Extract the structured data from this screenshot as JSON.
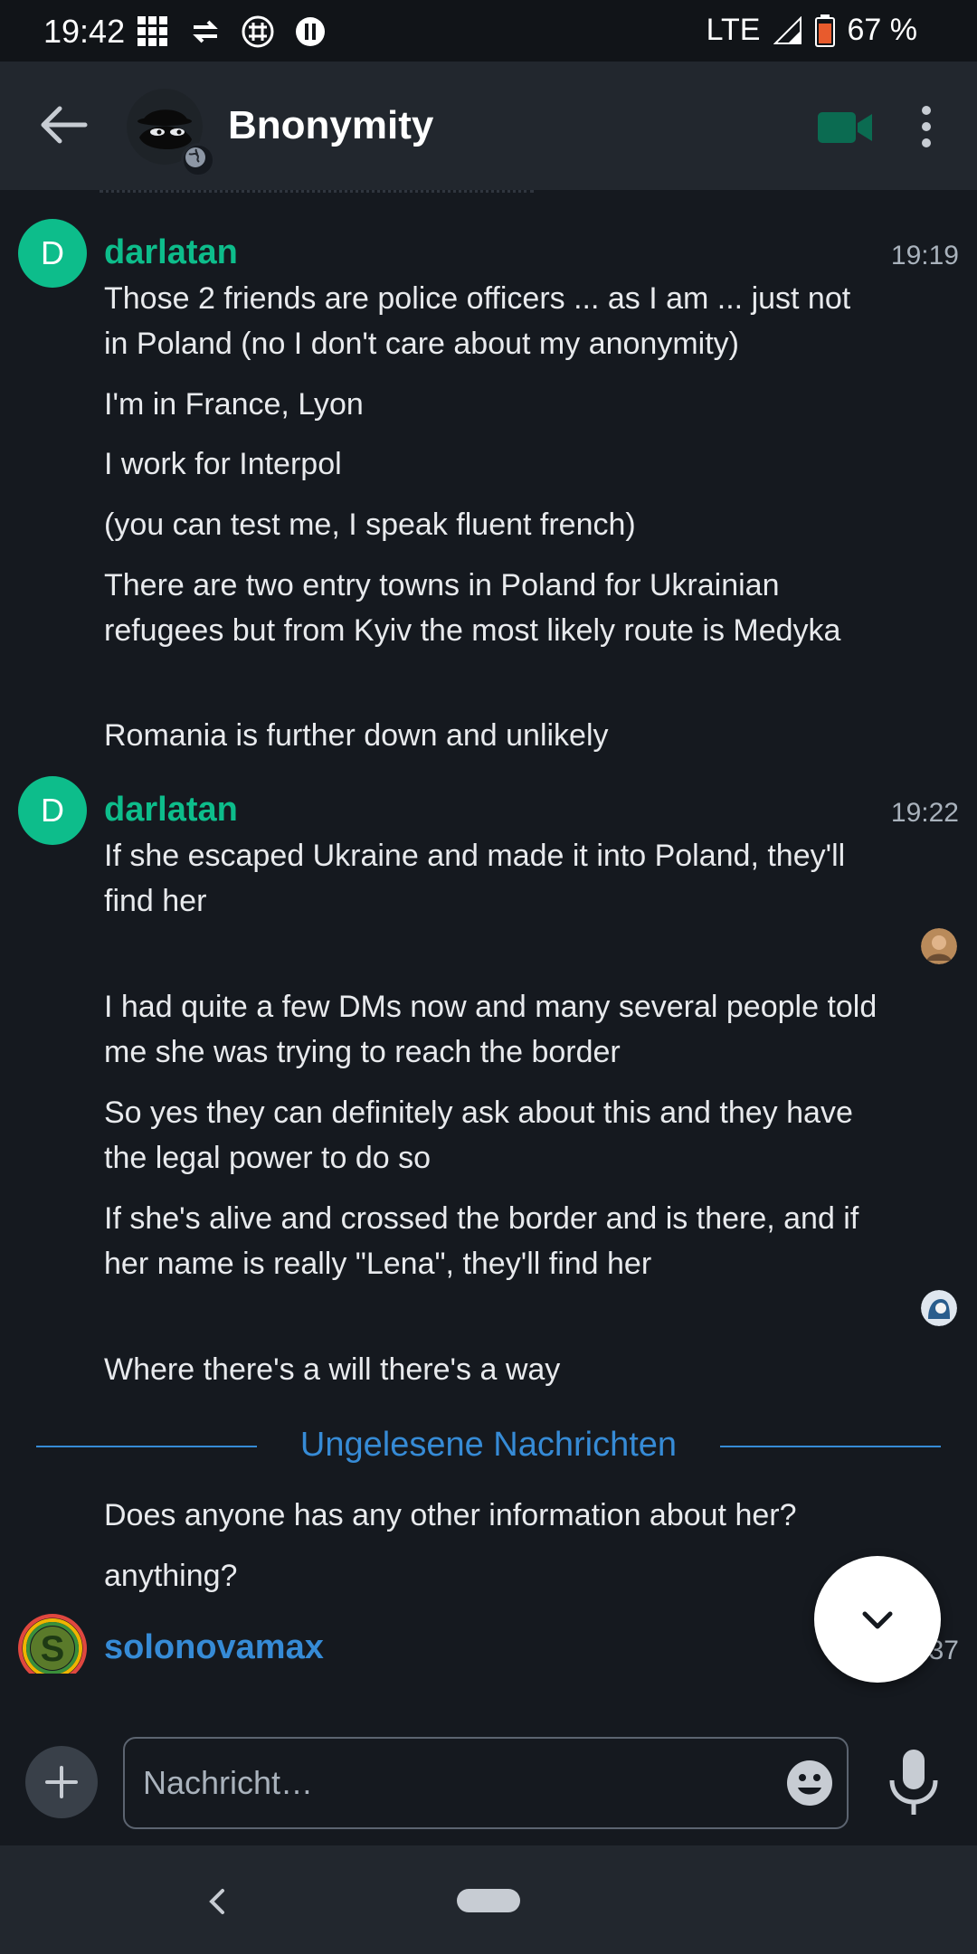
{
  "status_bar": {
    "time": "19:42",
    "network": "LTE",
    "battery": "67 %",
    "icons": [
      "grid-icon",
      "swap-icon",
      "hash-icon",
      "notification-icon",
      "signal-icon",
      "battery-icon"
    ]
  },
  "app_bar": {
    "room_name": "Bnonymity",
    "icons": [
      "back-arrow-icon",
      "globe-icon",
      "video-call-icon",
      "more-vert-icon"
    ]
  },
  "timeline": {
    "groups": [
      {
        "avatar_letter": "D",
        "sender": "darlatan",
        "time": "19:19",
        "messages": [
          "Those 2 friends are police officers ... as I am ... just not in Poland (no I don't care about my anonymity)",
          "I'm in France, Lyon",
          "I work for Interpol",
          "(you can test me, I speak fluent french)",
          "There are two entry towns in Poland for Ukrainian refugees but from Kyiv the most likely route is Medyka",
          "Romania is further down and unlikely"
        ]
      },
      {
        "avatar_letter": "D",
        "sender": "darlatan",
        "time": "19:22",
        "messages": [
          "If she escaped Ukraine and made it into Poland, they'll find her",
          "I had quite a few DMs now and many several people told me she was trying to reach the border",
          "So yes they can definitely ask about this and they have the legal power to do so",
          "If she's alive and crossed the border and is there, and if her name is really \"Lena\", they'll find her",
          "Where there's a will there's a way"
        ]
      }
    ],
    "unread_divider": "Ungelesene Nachrichten",
    "unread_messages": [
      "Does anyone has any other information about her?",
      "anything?"
    ],
    "next_sender": {
      "sender": "solonovamax",
      "time_fragment": "37"
    }
  },
  "composer": {
    "placeholder": "Nachricht…",
    "icons": [
      "add-icon",
      "emoji-icon",
      "mic-icon"
    ]
  },
  "colors": {
    "background": "#15191f",
    "appbar": "#22272e",
    "accent_green": "#0dbd8b",
    "accent_blue": "#368bd6"
  }
}
